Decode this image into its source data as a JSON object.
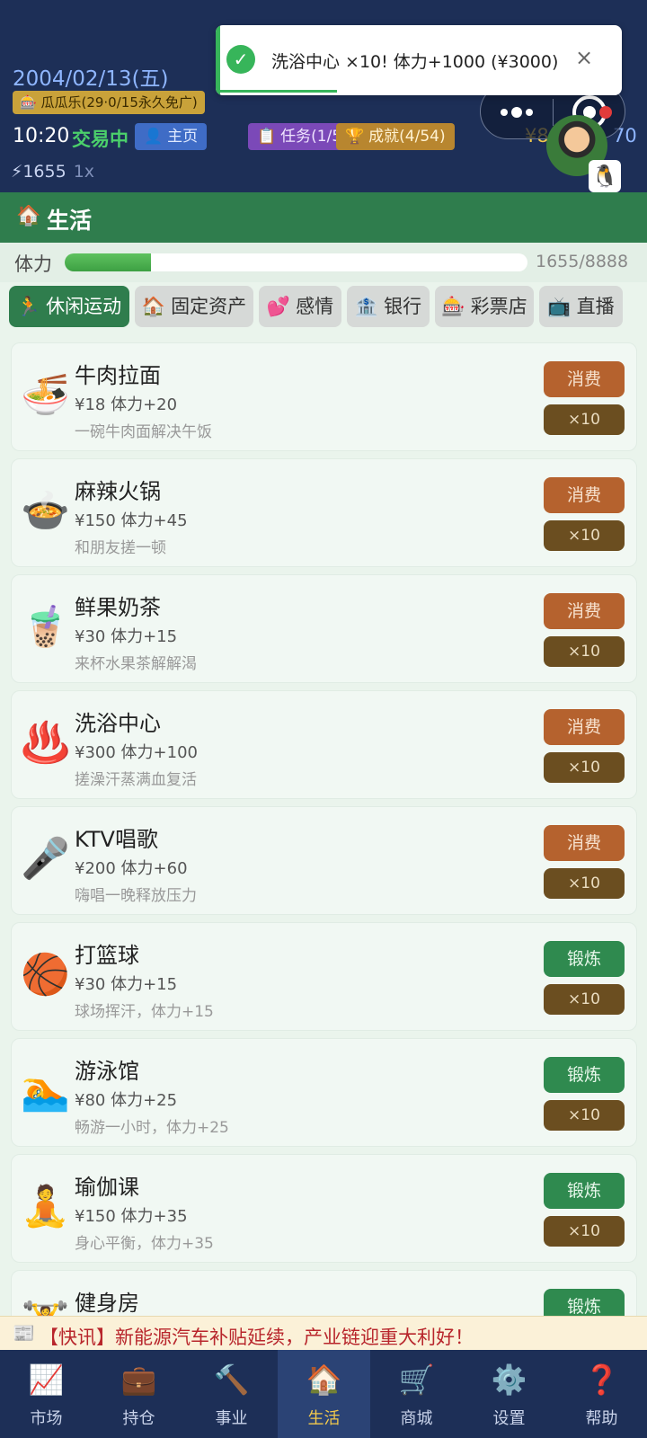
{
  "header": {
    "date": "2004/02/13(五)",
    "lottery_badge": "瓜瓜乐(29·0/15永久免广)",
    "time": "10:20",
    "trading_status": "交易中",
    "buttons": {
      "home": "主页",
      "tasks": "任务(1/5)",
      "achievements": "成就(4/54)"
    },
    "energy": "⚡1655",
    "speed": "1x",
    "money_partial": "¥8",
    "money_partial_right": "70"
  },
  "toast": {
    "message": "洗浴中心 ×10! 体力+1000 (¥3000)",
    "close": "×"
  },
  "section": {
    "title": "生活"
  },
  "stamina": {
    "label": "体力",
    "value": "1655/8888",
    "fraction": 0.186
  },
  "tabs": [
    {
      "label": "休闲运动",
      "icon": "🏃",
      "active": true
    },
    {
      "label": "固定资产",
      "icon": "🏠",
      "active": false
    },
    {
      "label": "感情",
      "icon": "💕",
      "active": false
    },
    {
      "label": "银行",
      "icon": "🏦",
      "active": false
    },
    {
      "label": "彩票店",
      "icon": "🎰",
      "active": false
    },
    {
      "label": "直播",
      "icon": "📺",
      "active": false
    }
  ],
  "items": [
    {
      "icon": "🍜",
      "name": "牛肉拉面",
      "stats": "¥18  体力+20",
      "desc": "一碗牛肉面解决午饭",
      "action": "消费",
      "kind": "consume",
      "multi": "×10"
    },
    {
      "icon": "🍲",
      "name": "麻辣火锅",
      "stats": "¥150  体力+45",
      "desc": "和朋友搓一顿",
      "action": "消费",
      "kind": "consume",
      "multi": "×10"
    },
    {
      "icon": "🧋",
      "name": "鲜果奶茶",
      "stats": "¥30  体力+15",
      "desc": "来杯水果茶解解渴",
      "action": "消费",
      "kind": "consume",
      "multi": "×10"
    },
    {
      "icon": "♨️",
      "name": "洗浴中心",
      "stats": "¥300  体力+100",
      "desc": "搓澡汗蒸满血复活",
      "action": "消费",
      "kind": "consume",
      "multi": "×10"
    },
    {
      "icon": "🎤",
      "name": "KTV唱歌",
      "stats": "¥200  体力+60",
      "desc": "嗨唱一晚释放压力",
      "action": "消费",
      "kind": "consume",
      "multi": "×10"
    },
    {
      "icon": "🏀",
      "name": "打篮球",
      "stats": "¥30  体力+15",
      "desc": "球场挥汗，体力+15",
      "action": "锻炼",
      "kind": "exercise",
      "multi": "×10"
    },
    {
      "icon": "🏊",
      "name": "游泳馆",
      "stats": "¥80  体力+25",
      "desc": "畅游一小时，体力+25",
      "action": "锻炼",
      "kind": "exercise",
      "multi": "×10"
    },
    {
      "icon": "🧘",
      "name": "瑜伽课",
      "stats": "¥150  体力+35",
      "desc": "身心平衡，体力+35",
      "action": "锻炼",
      "kind": "exercise",
      "multi": "×10"
    },
    {
      "icon": "🏋️",
      "name": "健身房",
      "stats": "",
      "desc": "",
      "action": "锻炼",
      "kind": "exercise",
      "multi": "×10"
    }
  ],
  "ticker": {
    "icon": "📰",
    "text": "【快讯】新能源汽车补贴延续，产业链迎重大利好！"
  },
  "nav": [
    {
      "label": "市场",
      "icon": "📈",
      "active": false
    },
    {
      "label": "持仓",
      "icon": "💼",
      "active": false
    },
    {
      "label": "事业",
      "icon": "🔨",
      "active": false
    },
    {
      "label": "生活",
      "icon": "🏠",
      "active": true
    },
    {
      "label": "商城",
      "icon": "🛒",
      "active": false
    },
    {
      "label": "设置",
      "icon": "⚙️",
      "active": false
    },
    {
      "label": "帮助",
      "icon": "❓",
      "active": false
    }
  ]
}
